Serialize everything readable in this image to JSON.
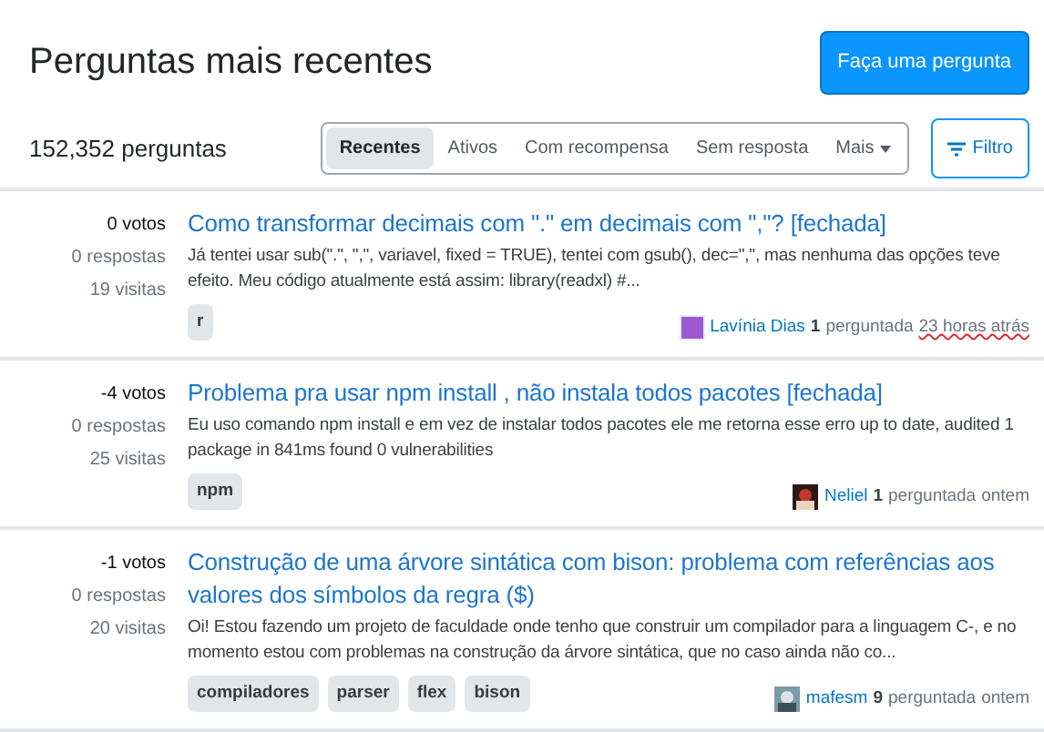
{
  "header": {
    "title": "Perguntas mais recentes",
    "ask_button": "Faça uma pergunta"
  },
  "count": "152,352 perguntas",
  "filters": [
    {
      "label": "Recentes",
      "selected": true
    },
    {
      "label": "Ativos",
      "selected": false
    },
    {
      "label": "Com recompensa",
      "selected": false
    },
    {
      "label": "Sem resposta",
      "selected": false
    },
    {
      "label": "Mais",
      "selected": false
    }
  ],
  "filter_button": "Filtro",
  "questions": [
    {
      "votes": "0 votos",
      "answers": "0 respostas",
      "views": "19 visitas",
      "title": "Como transformar decimais com \".\" em decimais com \",\"? [fechada]",
      "excerpt": "Já tentei usar sub(\".\", \",\", variavel, fixed = TRUE), tentei com gsub(), dec=\",\", mas nenhuma das opções teve efeito. Meu código atualmente está assim: library(readxl) #...",
      "tags": [
        "r"
      ],
      "user": "Lavínia Dias",
      "reputation": "1",
      "action": "perguntada",
      "time": "23 horas atrás",
      "time_flagged": true
    },
    {
      "votes": "-4 votos",
      "answers": "0 respostas",
      "views": "25 visitas",
      "title": "Problema pra usar npm install , não instala todos pacotes [fechada]",
      "excerpt": "Eu uso comando npm install e em vez de instalar todos pacotes ele me retorna esse erro up to date, audited 1 package in 841ms found 0 vulnerabilities",
      "tags": [
        "npm"
      ],
      "user": "Neliel",
      "reputation": "1",
      "action": "perguntada",
      "time": "ontem",
      "time_flagged": false
    },
    {
      "votes": "-1 votos",
      "answers": "0 respostas",
      "views": "20 visitas",
      "title": "Construção de uma árvore sintática com bison: problema com referências aos valores dos símbolos da regra ($)",
      "excerpt": "Oi! Estou fazendo um projeto de faculdade onde tenho que construir um compilador para a linguagem C-, e no momento estou com problemas na construção da árvore sintática, que no caso ainda não co...",
      "tags": [
        "compiladores",
        "parser",
        "flex",
        "bison"
      ],
      "user": "mafesm",
      "reputation": "9",
      "action": "perguntada",
      "time": "ontem",
      "time_flagged": false
    }
  ]
}
